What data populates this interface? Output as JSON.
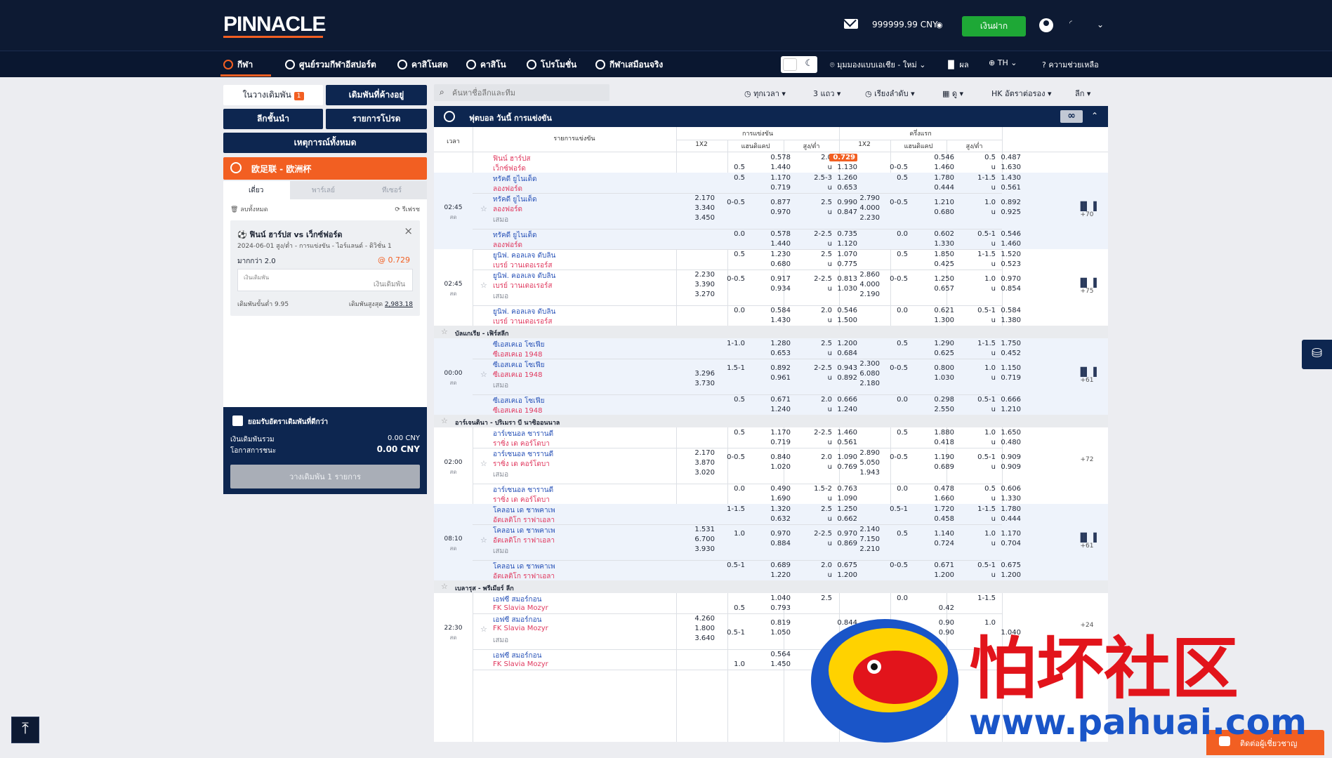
{
  "header": {
    "logo": "PINNACLE",
    "balance": "999999.99 CNY",
    "deposit_label": "เงินฝาก"
  },
  "nav": {
    "items": [
      {
        "label": "กีฬา",
        "icon": "soccer-ball-icon"
      },
      {
        "label": "ศูนย์รวมกีฬาอีสปอร์ต",
        "icon": "headset-icon"
      },
      {
        "label": "คาสิโนสด",
        "icon": "chip-icon"
      },
      {
        "label": "คาสิโน",
        "icon": "cards-icon"
      },
      {
        "label": "โปรโมชั่น",
        "icon": "gift-icon"
      },
      {
        "label": "กีฬาเสมือนจริง",
        "icon": "horse-icon"
      }
    ],
    "region": "มุมมองแบบเอเชีย - ใหม่",
    "results": "ผล",
    "language": "TH",
    "help": "ความช่วยเหลือ"
  },
  "left": {
    "tab_bets": "ในวางเดิมพัน",
    "tab_bets_badge": "1",
    "tab_pending": "เดิมพันที่ค้างอยู่",
    "btn_top_leagues": "ลีกชั้นนำ",
    "btn_favorites": "รายการโปรด",
    "btn_all_events": "เหตุการณ์ทั้งหมด",
    "league_bar": "欧足联 - 欧洲杯",
    "slip_tabs": [
      "เดี่ยว",
      "พาร์เลย์",
      "ทีเซอร์"
    ],
    "clear_all": "ลบทั้งหมด",
    "refresh": "รีเฟรช",
    "bet": {
      "title": "ฟินน์ ฮาร์ปส vs เว็กซ์ฟอร์ด",
      "sub": "2024-06-01 สูง/ต่ำ - การแข่งขัน - ไอร์แลนด์ - ดิวิชั่น 1",
      "pick": "มากกว่า 2.0",
      "odds": "@ 0.729",
      "stake_label": "เงินเดิมพัน",
      "stake_placeholder": "เงินเดิมพัน",
      "min_label": "เดิมพันขั้นต่ำ 9.95",
      "max_label": "เดิมพันสูงสุด",
      "max_value": "2,983.18"
    },
    "accept_label": "ยอมรับอัตราเดิมพันที่ดีกว่า",
    "total_label": "เงินเดิมพันรวม",
    "total_value": "0.00 CNY",
    "win_label": "โอกาสการชนะ",
    "win_value": "0.00 CNY",
    "place_label": "วางเดิมพัน 1 รายการ"
  },
  "filters": {
    "search_placeholder": "ค้นหาชื่อลีกและทีม",
    "time": "ทุกเวลา",
    "lines": "3 แถว",
    "sort": "เรียงลำดับ",
    "view": "ดู",
    "odds_format": "HK อัตราต่อรอง",
    "league": "ลีก"
  },
  "sport_header": {
    "title": "ฟุตบอล วันนี้ การแข่งขัน",
    "inf": "∞"
  },
  "table_headers": {
    "time": "เวลา",
    "match": "รายการแข่งขัน",
    "full": "การแข่งขัน",
    "half": "ครึ่งแรก",
    "x12": "1X2",
    "hdp": "แฮนดิแคป",
    "ou": "สูง/ต่ำ"
  },
  "leagues": [
    {
      "name": "บัลแกเรีย - เฟิร์สลีก"
    },
    {
      "name": "อาร์เจนตินา - ปริเมรา บี นาซิออนนาล"
    },
    {
      "name": "เบลารุส - พรีเมียร์ ลีก"
    }
  ],
  "matches": [
    {
      "time": "",
      "live": "",
      "more": "",
      "rows": [
        {
          "t1": "ฟินน์ ฮาร์ปส",
          "t2": "เว็กซ์ฟอร์ด",
          "red": true,
          "x": [
            "",
            "",
            ""
          ],
          "hl": "",
          "h1": "0.578",
          "hd": "0.5",
          "h2": "1.440",
          "ol": "2.0",
          "o1": "0.729",
          "ou": "u",
          "o2": "1.130",
          "fx": [
            "",
            "",
            ""
          ],
          "fhl": "",
          "fh1": "0.546",
          "fhd": "0-0.5",
          "fh2": "1.460",
          "fol": "0.5",
          "fo1": "0.487",
          "fou": "u",
          "fo2": "1.630"
        }
      ]
    },
    {
      "time": "02:45",
      "live": "สด",
      "more": "+70",
      "rows": [
        {
          "t1": "ทรัคดี ยูไนเต็ด",
          "t2": "ลองฟอร์ด",
          "x": [
            "",
            "",
            ""
          ],
          "hl": "0.5",
          "h1": "1.170",
          "hd": "",
          "h2": "0.719",
          "ol": "2.5-3",
          "o1": "1.260",
          "ou": "u",
          "o2": "0.653",
          "fx": [
            "",
            "",
            ""
          ],
          "fhl": "0.5",
          "fh1": "1.780",
          "fhd": "",
          "fh2": "0.444",
          "fol": "1-1.5",
          "fo1": "1.430",
          "fou": "u",
          "fo2": "0.561"
        },
        {
          "t1": "ทรัคดี ยูไนเต็ด",
          "t2": "ลองฟอร์ด",
          "draw": "เสมอ",
          "x": [
            "2.170",
            "3.340",
            "3.450"
          ],
          "hl": "0-0.5",
          "h1": "0.877",
          "hd": "",
          "h2": "0.970",
          "ol": "2.5",
          "o1": "0.990",
          "ou": "u",
          "o2": "0.847",
          "fx": [
            "2.790",
            "4.000",
            "2.230"
          ],
          "fhl": "0-0.5",
          "fh1": "1.210",
          "fhd": "",
          "fh2": "0.680",
          "fol": "1.0",
          "fo1": "0.892",
          "fou": "u",
          "fo2": "0.925"
        },
        {
          "t1": "ทรัคดี ยูไนเต็ด",
          "t2": "ลองฟอร์ด",
          "x": [
            "",
            "",
            ""
          ],
          "hl": "0.0",
          "h1": "0.578",
          "hd": "",
          "h2": "1.440",
          "ol": "2-2.5",
          "o1": "0.735",
          "ou": "u",
          "o2": "1.120",
          "fx": [
            "",
            "",
            ""
          ],
          "fhl": "0.0",
          "fh1": "0.602",
          "fhd": "",
          "fh2": "1.330",
          "fol": "0.5-1",
          "fo1": "0.546",
          "fou": "u",
          "fo2": "1.460"
        }
      ]
    },
    {
      "time": "02:45",
      "live": "สด",
      "more": "+75",
      "rows": [
        {
          "t1": "ยูนิฟ. คอลเลจ ดับลิน",
          "t2": "เบรย์ วานเดอเรอร์ส",
          "x": [
            "",
            "",
            ""
          ],
          "hl": "0.5",
          "h1": "1.230",
          "hd": "",
          "h2": "0.680",
          "ol": "2.5",
          "o1": "1.070",
          "ou": "u",
          "o2": "0.775",
          "fx": [
            "",
            "",
            ""
          ],
          "fhl": "0.5",
          "fh1": "1.850",
          "fhd": "",
          "fh2": "0.425",
          "fol": "1-1.5",
          "fo1": "1.520",
          "fou": "u",
          "fo2": "0.523"
        },
        {
          "t1": "ยูนิฟ. คอลเลจ ดับลิน",
          "t2": "เบรย์ วานเดอเรอร์ส",
          "draw": "เสมอ",
          "x": [
            "2.230",
            "3.390",
            "3.270"
          ],
          "hl": "0-0.5",
          "h1": "0.917",
          "hd": "",
          "h2": "0.934",
          "ol": "2-2.5",
          "o1": "0.813",
          "ou": "u",
          "o2": "1.030",
          "fx": [
            "2.860",
            "4.000",
            "2.190"
          ],
          "fhl": "0-0.5",
          "fh1": "1.250",
          "fhd": "",
          "fh2": "0.657",
          "fol": "1.0",
          "fo1": "0.970",
          "fou": "u",
          "fo2": "0.854"
        },
        {
          "t1": "ยูนิฟ. คอลเลจ ดับลิน",
          "t2": "เบรย์ วานเดอเรอร์ส",
          "x": [
            "",
            "",
            ""
          ],
          "hl": "0.0",
          "h1": "0.584",
          "hd": "",
          "h2": "1.430",
          "ol": "2.0",
          "o1": "0.546",
          "ou": "u",
          "o2": "1.500",
          "fx": [
            "",
            "",
            ""
          ],
          "fhl": "0.0",
          "fh1": "0.621",
          "fhd": "",
          "fh2": "1.300",
          "fol": "0.5-1",
          "fo1": "0.584",
          "fou": "u",
          "fo2": "1.380"
        }
      ]
    },
    {
      "time": "00:00",
      "live": "สด",
      "more": "+61",
      "rows": [
        {
          "t1": "ซีเอสเคเอ โซเฟีย",
          "t2": "ซีเอสเคเอ 1948",
          "x": [
            "",
            "",
            ""
          ],
          "hl": "1-1.0",
          "h1": "1.280",
          "hd": "",
          "h2": "0.653",
          "ol": "2.5",
          "o1": "1.200",
          "ou": "u",
          "o2": "0.684",
          "fx": [
            "",
            "",
            ""
          ],
          "fhl": "0.5",
          "fh1": "1.290",
          "fhd": "",
          "fh2": "0.625",
          "fol": "1-1.5",
          "fo1": "1.750",
          "fou": "u",
          "fo2": "0.452"
        },
        {
          "t1": "ซีเอสเคเอ โซเฟีย",
          "t2": "ซีเอสเคเอ 1948",
          "draw": "เสมอ",
          "x": [
            "",
            "3.296",
            "3.730"
          ],
          "hl": "1.5-1",
          "h1": "0.892",
          "hd": "",
          "h2": "0.961",
          "ol": "2-2.5",
          "o1": "0.943",
          "ou": "u",
          "o2": "0.892",
          "fx": [
            "2.300",
            "6.080",
            "2.180"
          ],
          "fhl": "0-0.5",
          "fh1": "0.800",
          "fhd": "",
          "fh2": "1.030",
          "fol": "1.0",
          "fo1": "1.150",
          "fou": "u",
          "fo2": "0.719"
        },
        {
          "t1": "ซีเอสเคเอ โซเฟีย",
          "t2": "ซีเอสเคเอ 1948",
          "x": [
            "",
            "",
            ""
          ],
          "hl": "0.5",
          "h1": "0.671",
          "hd": "",
          "h2": "1.240",
          "ol": "2.0",
          "o1": "0.666",
          "ou": "u",
          "o2": "1.240",
          "fx": [
            "",
            "",
            ""
          ],
          "fhl": "0.0",
          "fh1": "0.298",
          "fhd": "",
          "fh2": "2.550",
          "fol": "0.5-1",
          "fo1": "0.666",
          "fou": "u",
          "fo2": "1.210"
        }
      ]
    },
    {
      "time": "02:00",
      "live": "สด",
      "more": "+72",
      "rows": [
        {
          "t1": "อาร์เซนอล ซารานดี",
          "t2": "ราซิ่ง เด คอร์โดบา",
          "x": [
            "",
            "",
            ""
          ],
          "hl": "0.5",
          "h1": "1.170",
          "hd": "",
          "h2": "0.719",
          "ol": "2-2.5",
          "o1": "1.460",
          "ou": "u",
          "o2": "0.561",
          "fx": [
            "",
            "",
            ""
          ],
          "fhl": "0.5",
          "fh1": "1.880",
          "fhd": "",
          "fh2": "0.418",
          "fol": "1.0",
          "fo1": "1.650",
          "fou": "u",
          "fo2": "0.480"
        },
        {
          "t1": "อาร์เซนอล ซารานดี",
          "t2": "ราซิ่ง เด คอร์โดบา",
          "draw": "เสมอ",
          "x": [
            "2.170",
            "3.870",
            "3.020"
          ],
          "hl": "0-0.5",
          "h1": "0.840",
          "hd": "",
          "h2": "1.020",
          "ol": "2.0",
          "o1": "1.090",
          "ou": "u",
          "o2": "0.769",
          "fx": [
            "2.890",
            "5.050",
            "1.943"
          ],
          "fhl": "0-0.5",
          "fh1": "1.190",
          "fhd": "",
          "fh2": "0.689",
          "fol": "0.5-1",
          "fo1": "0.909",
          "fou": "u",
          "fo2": "0.909"
        },
        {
          "t1": "อาร์เซนอล ซารานดี",
          "t2": "ราซิ่ง เด คอร์โดบา",
          "x": [
            "",
            "",
            ""
          ],
          "hl": "0.0",
          "h1": "0.490",
          "hd": "",
          "h2": "1.690",
          "ol": "1.5-2",
          "o1": "0.763",
          "ou": "u",
          "o2": "1.090",
          "fx": [
            "",
            "",
            ""
          ],
          "fhl": "0.0",
          "fh1": "0.478",
          "fhd": "",
          "fh2": "1.660",
          "fol": "0.5",
          "fo1": "0.606",
          "fou": "u",
          "fo2": "1.330"
        }
      ]
    },
    {
      "time": "08:10",
      "live": "สด",
      "more": "+61",
      "rows": [
        {
          "t1": "โคลอน เด ชาพคาเพ",
          "t2": "อัตเลติโก ราฟาเอลา",
          "x": [
            "",
            "",
            ""
          ],
          "hl": "1-1.5",
          "h1": "1.320",
          "hd": "",
          "h2": "0.632",
          "ol": "2.5",
          "o1": "1.250",
          "ou": "u",
          "o2": "0.662",
          "fx": [
            "",
            "",
            ""
          ],
          "fhl": "0.5-1",
          "fh1": "1.720",
          "fhd": "",
          "fh2": "0.458",
          "fol": "1-1.5",
          "fo1": "1.780",
          "fou": "u",
          "fo2": "0.444"
        },
        {
          "t1": "โคลอน เด ชาพคาเพ",
          "t2": "อัตเลติโก ราฟาเอลา",
          "draw": "เสมอ",
          "x": [
            "1.531",
            "6.700",
            "3.930"
          ],
          "hl": "1.0",
          "h1": "0.970",
          "hd": "",
          "h2": "0.884",
          "ol": "2-2.5",
          "o1": "0.970",
          "ou": "u",
          "o2": "0.869",
          "fx": [
            "2.140",
            "7.150",
            "2.210"
          ],
          "fhl": "0.5",
          "fh1": "1.140",
          "fhd": "",
          "fh2": "0.724",
          "fol": "1.0",
          "fo1": "1.170",
          "fou": "u",
          "fo2": "0.704"
        },
        {
          "t1": "โคลอน เด ชาพคาเพ",
          "t2": "อัตเลติโก ราฟาเอลา",
          "x": [
            "",
            "",
            ""
          ],
          "hl": "0.5-1",
          "h1": "0.689",
          "hd": "",
          "h2": "1.220",
          "ol": "2.0",
          "o1": "0.675",
          "ou": "u",
          "o2": "1.200",
          "fx": [
            "",
            "",
            ""
          ],
          "fhl": "0-0.5",
          "fh1": "0.671",
          "fhd": "",
          "fh2": "1.200",
          "fol": "0.5-1",
          "fo1": "0.675",
          "fou": "u",
          "fo2": "1.200"
        }
      ]
    },
    {
      "time": "22:30",
      "live": "สด",
      "more": "+24",
      "rows": [
        {
          "t1": "เอฟซี สมอร์กอน",
          "t2": "FK Slavia Mozyr",
          "x": [
            "",
            "",
            ""
          ],
          "hl": "",
          "h1": "1.040",
          "hd": "0.5",
          "h2": "0.793",
          "ol": "2.5",
          "o1": "",
          "ou": "",
          "o2": "",
          "fx": [
            "",
            "",
            ""
          ],
          "fhl": "0.0",
          "fh1": "",
          "fhd": "",
          "fh2": "0.42",
          "fol": "1-1.5",
          "fo1": "",
          "fou": "",
          "fo2": ""
        },
        {
          "t1": "เอฟซี สมอร์กอน",
          "t2": "FK Slavia Mozyr",
          "draw": "เสมอ",
          "x": [
            "4.260",
            "1.800",
            "3.640"
          ],
          "hl": "",
          "h1": "0.819",
          "hd": "0.5-1",
          "h2": "1.050",
          "ol": "",
          "o1": "0.844",
          "ou": "",
          "o2": "",
          "fx": [
            "",
            "",
            ""
          ],
          "fhl": "",
          "fh1": "0.90",
          "fhd": "0-0.5",
          "fh2": "0.90",
          "fol": "1.0",
          "fo1": "",
          "fou": "",
          "fo2": "1.040"
        },
        {
          "t1": "เอฟซี สมอร์กอน",
          "t2": "FK Slavia Mozyr",
          "x": [
            "",
            "",
            ""
          ],
          "hl": "",
          "h1": "0.564",
          "hd": "1.0",
          "h2": "1.450",
          "ol": "",
          "o1": "",
          "ou": "",
          "o2": "",
          "fx": [
            "",
            "",
            ""
          ],
          "fhl": "",
          "fh1": "",
          "fhd": "0.5",
          "fh2": "",
          "fol": "",
          "fo1": "",
          "fou": "",
          "fo2": ""
        }
      ]
    }
  ],
  "chat_label": "ติดต่อผู้เชี่ยวชาญ",
  "watermark": {
    "text": "怕坏社区",
    "url": "www.pahuai.com"
  }
}
